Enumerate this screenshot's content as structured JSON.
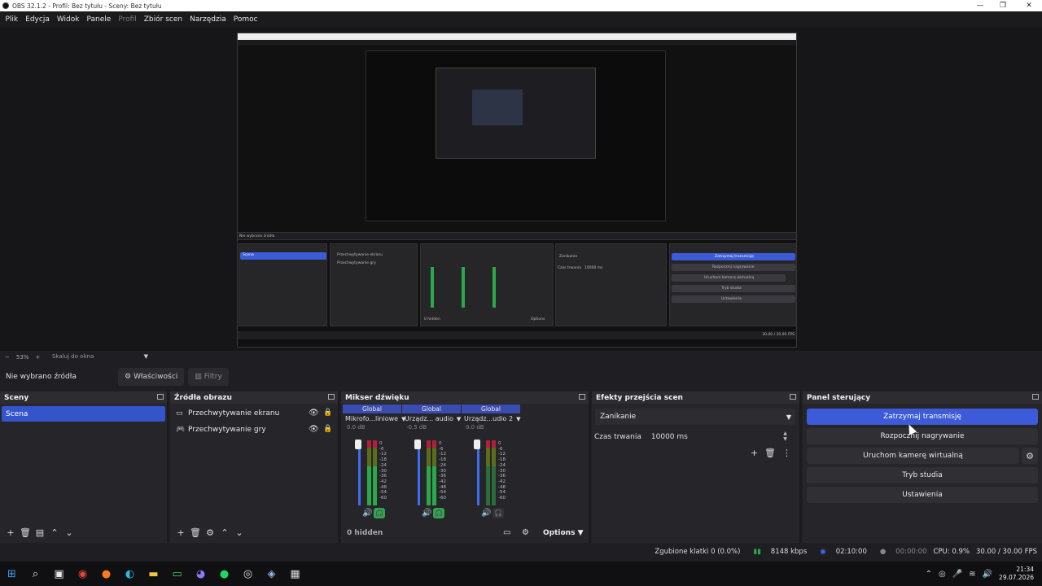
{
  "window": {
    "title": "OBS 32.1.2 - Profil: Bez tytułu - Sceny: Bez tytułu"
  },
  "menu": [
    "Plik",
    "Edycja",
    "Widok",
    "Panele",
    "Profil",
    "Zbiór scen",
    "Narzędzia",
    "Pomoc"
  ],
  "nested": {
    "stop_stream": "Zatrzymaj transmisję",
    "start_rec": "Rozpocznij nagrywanie",
    "virtual_cam": "Uruchom kamerę wirtualną",
    "studio": "Tryb studia",
    "settings": "Ustawienia",
    "no_source": "Nie wybrano źródła",
    "scene": "Scena",
    "src1": "Przechwytywanie ekranu",
    "src2": "Przechwytywanie gry",
    "fade": "Zanikanie",
    "dur_label": "Czas trwania",
    "dur_value": "10000 ms",
    "hidden": "0 hidden",
    "options": "Options",
    "fps": "30.00 / 30.00 FPS"
  },
  "zoom": {
    "minus": "−",
    "value": "53%",
    "plus": "+",
    "fit": "Skaluj do okna"
  },
  "source_bar": {
    "none_selected": "Nie wybrano źródła",
    "properties": "Właściwości",
    "filters": "Filtry"
  },
  "scenes": {
    "title": "Sceny",
    "items": [
      "Scena"
    ]
  },
  "sources": {
    "title": "Źródła obrazu",
    "items": [
      "Przechwytywanie ekranu",
      "Przechwytywanie gry"
    ]
  },
  "mixer": {
    "title": "Mikser dźwięku",
    "channels": [
      {
        "tag": "Global",
        "name": "Mikrofo...liniowe",
        "db": "0.0 dB"
      },
      {
        "tag": "Global",
        "name": "Urządz... audio",
        "db": "-0.5 dB"
      },
      {
        "tag": "Global",
        "name": "Urządz...udio 2",
        "db": "0.0 dB"
      }
    ],
    "ticks": [
      "0",
      "-6",
      "-12",
      "-18",
      "-24",
      "-30",
      "-36",
      "-42",
      "-48",
      "-54",
      "-60"
    ],
    "hidden": "0 hidden",
    "options": "Options"
  },
  "transitions": {
    "title": "Efekty przejścia scen",
    "selected": "Zanikanie",
    "duration_label": "Czas trwania",
    "duration_value": "10000 ms"
  },
  "controls": {
    "title": "Panel sterujący",
    "stop_stream": "Zatrzymaj transmisję",
    "start_recording": "Rozpocznij nagrywanie",
    "virtual_cam": "Uruchom kamerę wirtualną",
    "studio_mode": "Tryb studia",
    "settings": "Ustawienia"
  },
  "status": {
    "dropped": "Zgubione klatki 0 (0.0%)",
    "kbps": "8148 kbps",
    "stream_time": "02:10:00",
    "rec_time": "00:00:00",
    "cpu": "CPU: 0.9%",
    "fps": "30.00 / 30.00 FPS"
  },
  "taskbar": {
    "time": "21:34",
    "date": "29.07.2026"
  },
  "colors": {
    "accent": "#3d5ad8",
    "panel": "#25252a",
    "meter_green": "#2aa84b",
    "meter_red": "#b0203a"
  }
}
